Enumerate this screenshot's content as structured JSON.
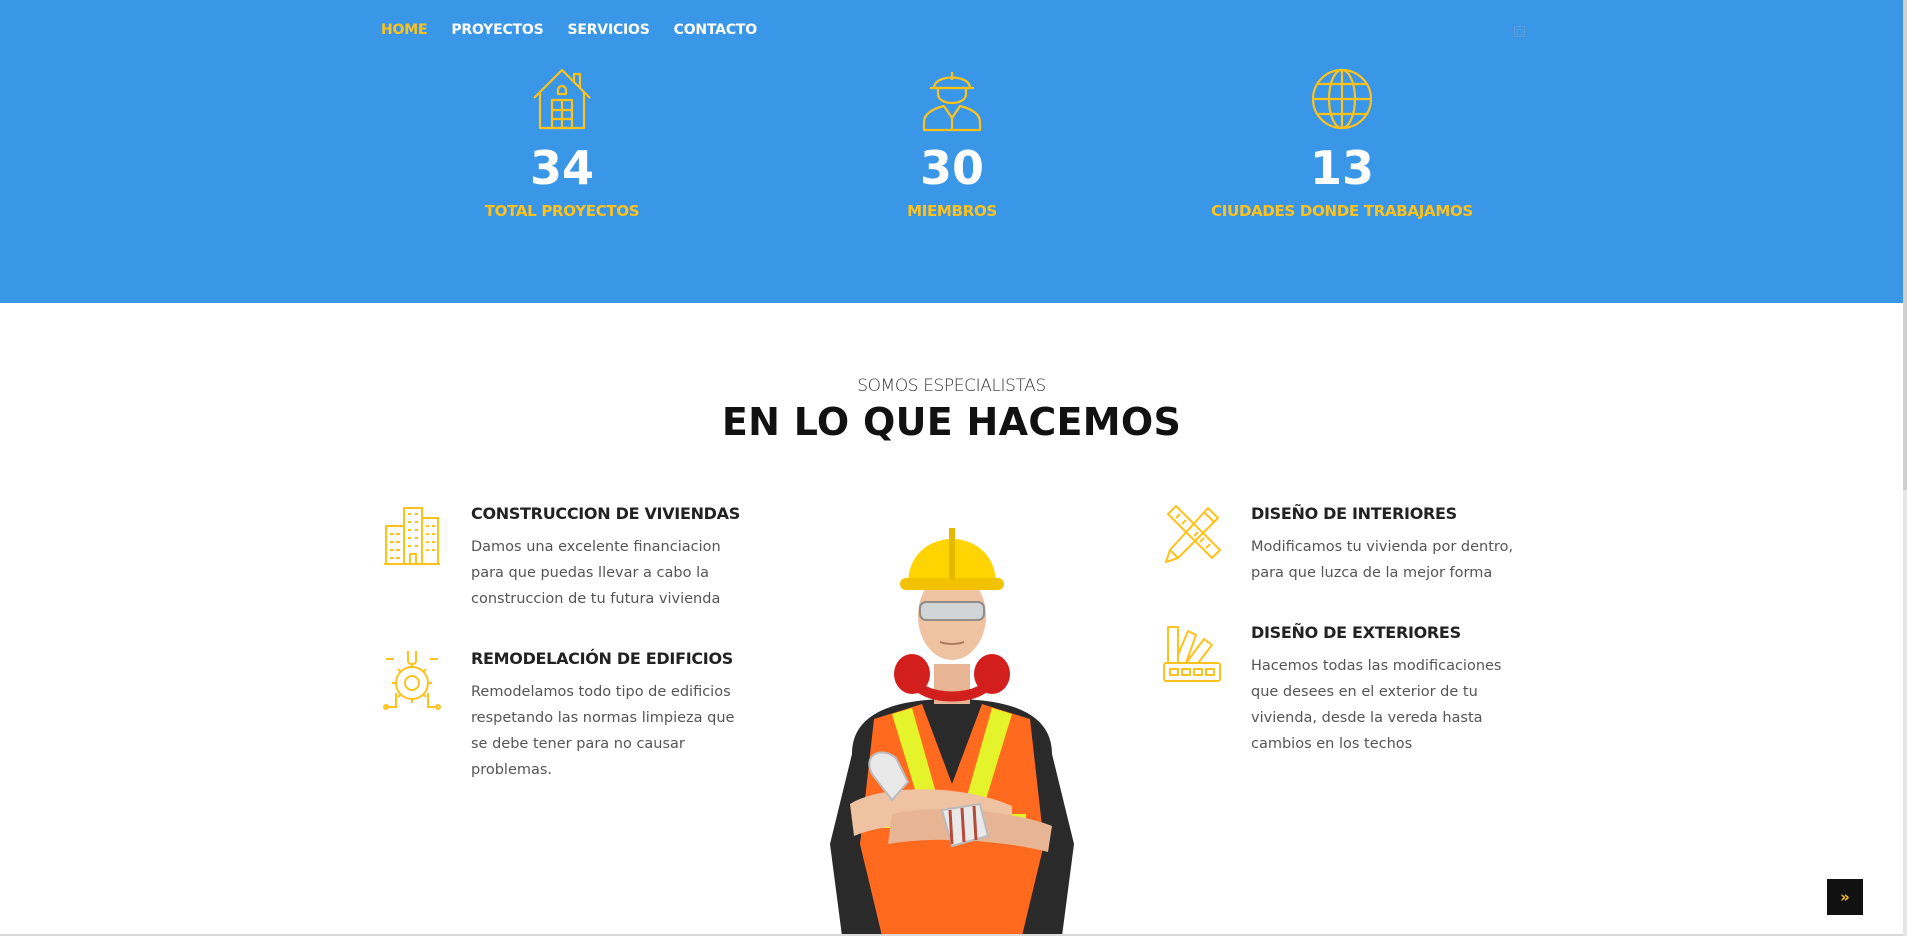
{
  "nav": {
    "items": [
      {
        "label": "HOME",
        "active": true
      },
      {
        "label": "PROYECTOS",
        "active": false
      },
      {
        "label": "SERVICIOS",
        "active": false
      },
      {
        "label": "CONTACTO",
        "active": false
      }
    ],
    "search_icon": "search-icon"
  },
  "stats": [
    {
      "value": "34",
      "label": "TOTAL PROYECTOS",
      "icon": "house-icon"
    },
    {
      "value": "30",
      "label": "MIEMBROS",
      "icon": "worker-helmet-icon"
    },
    {
      "value": "13",
      "label": "CIUDADES DONDE TRABAJAMOS",
      "icon": "globe-icon"
    }
  ],
  "section": {
    "kicker": "SOMOS ESPECIALISTAS",
    "title": "EN LO QUE HACEMOS"
  },
  "services": [
    {
      "title": "CONSTRUCCION DE VIVIENDAS",
      "desc": "Damos una excelente financiacion para que puedas llevar a cabo la construccion de tu futura vivienda",
      "icon": "buildings-icon"
    },
    {
      "title": "REMODELACIÓN DE EDIFICIOS",
      "desc": "Remodelamos todo tipo de edificios respetando las normas limpieza que se debe tener para no causar problemas.",
      "icon": "gear-wrench-icon"
    },
    {
      "title": "DISEÑO DE INTERIORES",
      "desc": "Modificamos tu vivienda por dentro, para que luzca de la mejor forma",
      "icon": "pencil-ruler-icon"
    },
    {
      "title": "DISEÑO DE EXTERIORES",
      "desc": "Hacemos todas las modificaciones que desees en el exterior de tu vivienda, desde la vereda hasta cambios en los techos",
      "icon": "color-swatch-icon"
    }
  ],
  "back_to_top": {
    "label": "»",
    "icon": "double-chevron-up-icon"
  },
  "colors": {
    "hero_bg": "#3a97e8",
    "accent": "#ffc21c",
    "text_dark": "#111111",
    "text_body": "#555555"
  }
}
